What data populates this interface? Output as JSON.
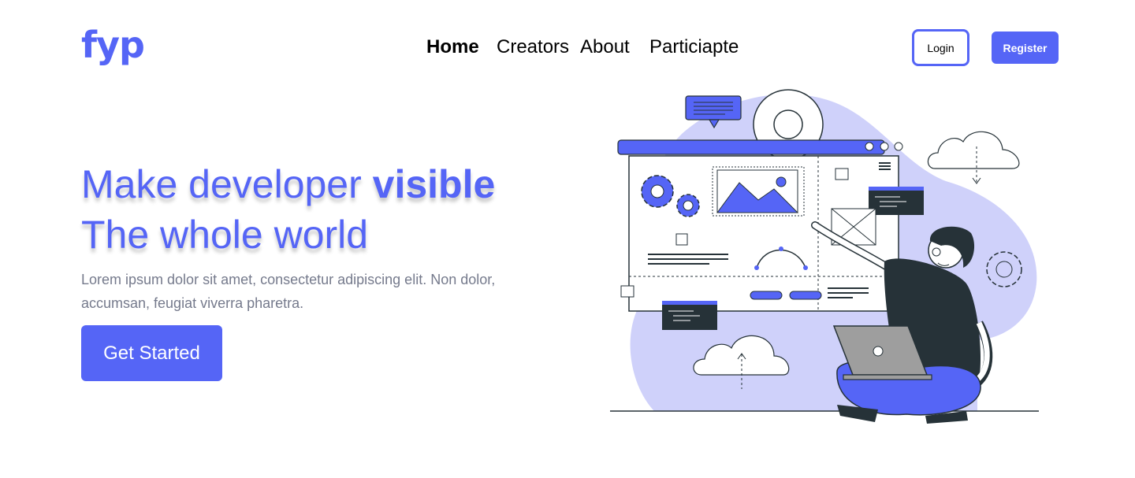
{
  "colors": {
    "brand": "#5565F6",
    "brand_light": "#CFD1FA",
    "dark": "#263238",
    "text_muted": "#757A8C"
  },
  "header": {
    "logo": "fyp",
    "nav": [
      {
        "label": "Home",
        "active": true
      },
      {
        "label": "Creators",
        "active": false
      },
      {
        "label": "About",
        "active": false
      },
      {
        "label": "Particiapte",
        "active": false
      }
    ],
    "login_label": "Login",
    "register_label": "Register"
  },
  "hero": {
    "title_line1_prefix": "Make developer ",
    "title_line1_highlight": "visible",
    "title_line2": "The whole world",
    "subtitle": "Lorem ipsum dolor sit amet, consectetur adipiscing elit. Non dolor, accumsan, feugiat viverra pharetra.",
    "cta_label": "Get Started"
  },
  "illustration": {
    "icons": [
      "gear-icon",
      "cloud-download-icon",
      "cloud-upload-icon",
      "chat-bubble-icon",
      "image-icon",
      "laptop-icon"
    ]
  }
}
